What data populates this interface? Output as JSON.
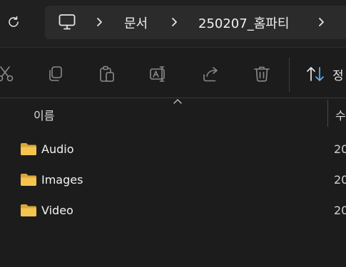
{
  "address_bar": {
    "breadcrumbs": [
      "문서",
      "250207_홈파티"
    ]
  },
  "toolbar": {
    "buttons": [
      "cut-icon",
      "copy-icon",
      "paste-icon",
      "rename-icon",
      "share-icon",
      "delete-icon"
    ],
    "sort_label": "정"
  },
  "columns": {
    "name": "이름",
    "size": "수"
  },
  "files": [
    {
      "name": "Audio",
      "date": "20"
    },
    {
      "name": "Images",
      "date": "20"
    },
    {
      "name": "Video",
      "date": "20"
    }
  ],
  "colors": {
    "background": "#1c1c1c",
    "breadcrumb_bg": "#2b2b2b",
    "folder": "#f4c44e",
    "accent": "#5fb2f2"
  }
}
